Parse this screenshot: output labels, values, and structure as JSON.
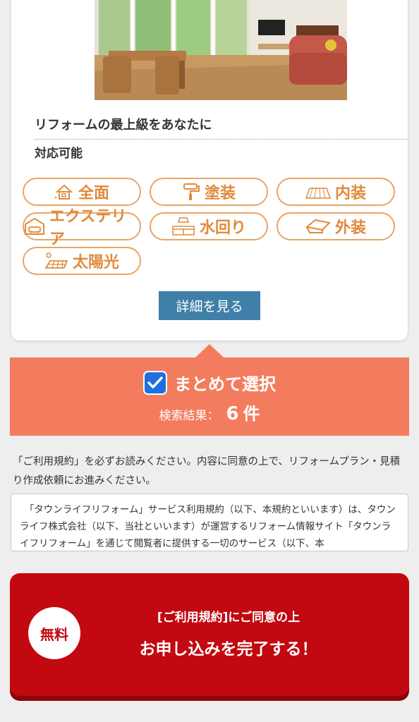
{
  "card": {
    "title": "リフォームの最上級をあなたに",
    "support_label": "対応可能",
    "tags": [
      {
        "label": "全面",
        "icon": "house-icon"
      },
      {
        "label": "塗装",
        "icon": "paint-roller-icon"
      },
      {
        "label": "内装",
        "icon": "flooring-icon"
      },
      {
        "label": "エクステリア",
        "icon": "garage-car-icon"
      },
      {
        "label": "水回り",
        "icon": "kitchen-icon"
      },
      {
        "label": "外装",
        "icon": "roof-icon"
      },
      {
        "label": "太陽光",
        "icon": "solar-panel-icon"
      }
    ],
    "detail_button": "詳細を見る"
  },
  "select_bar": {
    "label": "まとめて選択",
    "checked": true,
    "result_label": "検索結果：",
    "result_count": "6",
    "result_unit": "件"
  },
  "terms": {
    "notice": "「ご利用規約」を必ずお読みください。内容に同意の上で、リフォームプラン・見積り作成依頼にお進みください。",
    "text": "「タウンライフリフォーム」サービス利用規約（以下、本規約といいます）は、タウンライフ株式会社（以下、当社といいます）が運営するリフォーム情報サイト「タウンライフリフォーム」を通じて閲覧者に提供する一切のサービス（以下、本"
  },
  "submit": {
    "badge": "無料",
    "sub_label": "[ご利用規約]にご同意の上",
    "main_label": "お申し込みを完了する！"
  },
  "colors": {
    "accent_orange": "#e08a3c",
    "select_bar": "#f47c5e",
    "detail_button": "#3f7fa8",
    "submit_red": "#c20810",
    "checkbox_blue": "#1e6fe0"
  }
}
